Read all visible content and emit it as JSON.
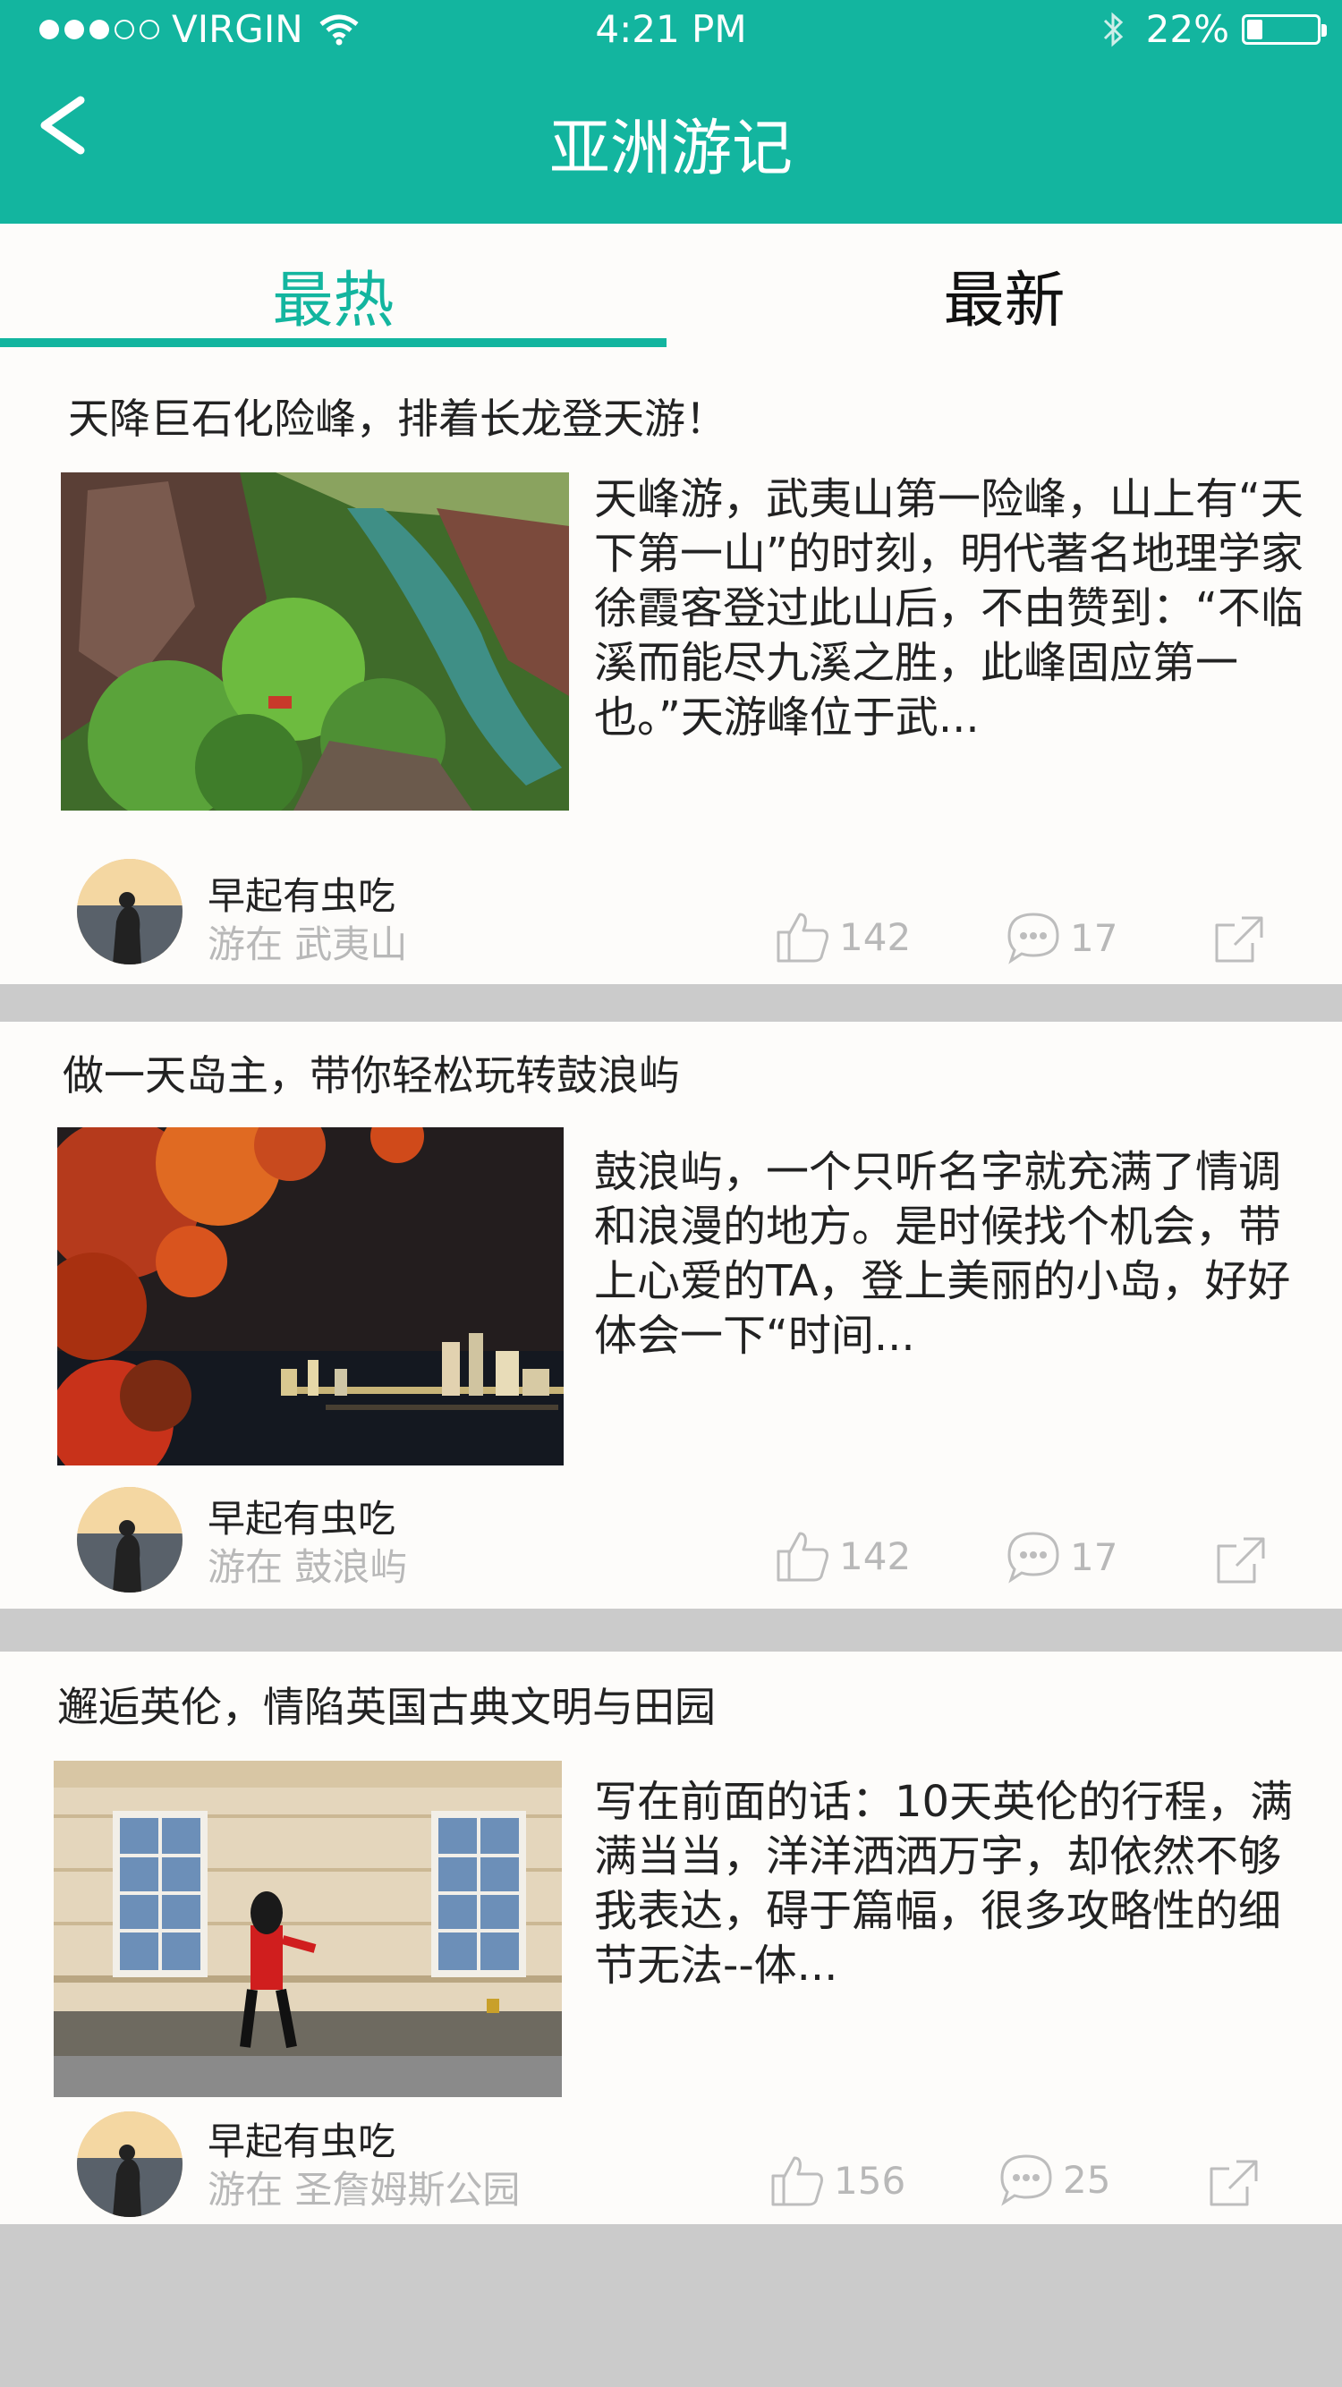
{
  "status_bar": {
    "carrier": "VIRGIN",
    "time": "4:21 PM",
    "battery": "22%",
    "battery_level": 0.22
  },
  "header": {
    "title": "亚洲游记",
    "back_icon": "chevron-left-icon"
  },
  "tabs": [
    {
      "label": "最热",
      "active": true
    },
    {
      "label": "最新",
      "active": false
    }
  ],
  "colors": {
    "accent": "#13b59f",
    "divider": "#cbcbcb",
    "muted_text": "#b8b8b8"
  },
  "posts": [
    {
      "title": "天降巨石化险峰，排着长龙登天游！",
      "excerpt": "天峰游，武夷山第一险峰，山上有“天下第一山”的时刻，明代著名地理学家徐霞客登过此山后，不由赞到：“不临溪而能尽九溪之胜，此峰固应第一也。”天游峰位于武...",
      "author": "早起有虫吃",
      "location": "游在  武夷山",
      "likes": "142",
      "comments": "17",
      "image_desc": "mountain-river-photo"
    },
    {
      "title": "做一天岛主，带你轻松玩转鼓浪屿",
      "excerpt": "鼓浪屿，一个只听名字就充满了情调和浪漫的地方。是时候找个机会，带上心爱的TA，登上美丽的小岛，好好体会一下“时间...",
      "author": "早起有虫吃",
      "location": "游在   鼓浪屿",
      "likes": "142",
      "comments": "17",
      "image_desc": "night-city-flowers-photo"
    },
    {
      "title": "邂逅英伦，情陷英国古典文明与田园",
      "excerpt": "写在前面的话：10天英伦的行程，满满当当，洋洋洒洒万字，却依然不够我表达，碍于篇幅，很多攻略性的细节无法--体...",
      "author": "早起有虫吃",
      "location": "游在   圣詹姆斯公园",
      "likes": "156",
      "comments": "25",
      "image_desc": "london-guard-photo"
    }
  ]
}
